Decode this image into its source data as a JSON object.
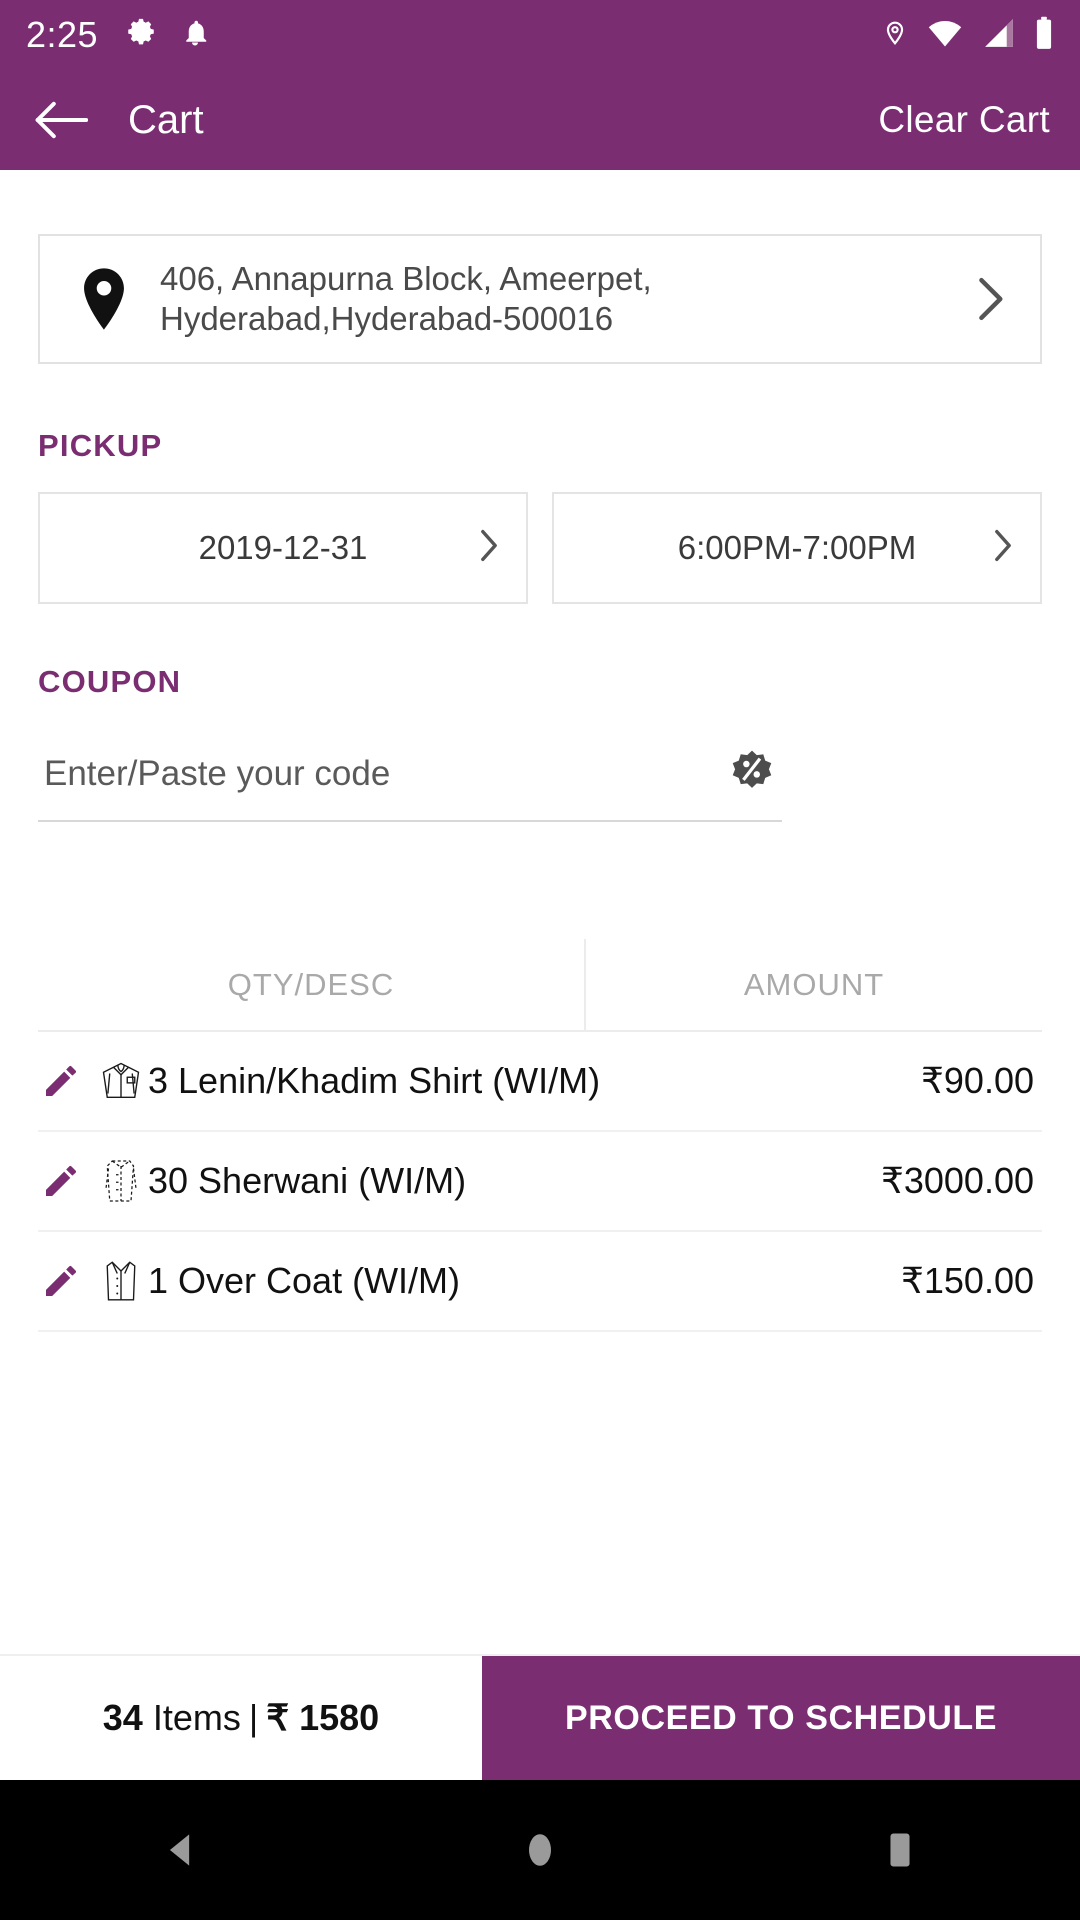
{
  "status_bar": {
    "time": "2:25",
    "left_icons": [
      "gear-icon",
      "bell-icon"
    ],
    "right_icons": [
      "location-pin-icon",
      "wifi-icon",
      "signal-icon",
      "battery-icon"
    ]
  },
  "app_bar": {
    "back_icon": "arrow-left-icon",
    "title": "Cart",
    "action_label": "Clear Cart"
  },
  "address": {
    "icon": "map-pin-icon",
    "line1": "406, Annapurna Block, Ameerpet,",
    "line2": "Hyderabad,Hyderabad-500016",
    "chevron": "chevron-right-icon"
  },
  "pickup": {
    "label": "PICKUP",
    "date": "2019-12-31",
    "time": "6:00PM-7:00PM"
  },
  "coupon": {
    "label": "COUPON",
    "placeholder": "Enter/Paste your code",
    "value": "",
    "icon": "discount-badge-icon"
  },
  "items_table": {
    "columns": [
      "QTY/DESC",
      "AMOUNT"
    ],
    "rows": [
      {
        "edit_icon": "pencil-icon",
        "garment_icon": "shirt-icon",
        "description": "3 Lenin/Khadim Shirt (WI/M)",
        "amount": "₹90.00"
      },
      {
        "edit_icon": "pencil-icon",
        "garment_icon": "sherwani-icon",
        "description": "30 Sherwani (WI/M)",
        "amount": "₹3000.00"
      },
      {
        "edit_icon": "pencil-icon",
        "garment_icon": "overcoat-icon",
        "description": "1 Over Coat (WI/M)",
        "amount": "₹150.00"
      }
    ]
  },
  "bottom_bar": {
    "item_count": "34",
    "items_word": "Items",
    "separator": "|",
    "total": "₹ 1580",
    "cta_label": "PROCEED TO SCHEDULE"
  },
  "nav_bar": {
    "back": "nav-back-icon",
    "home": "nav-home-icon",
    "recents": "nav-recents-icon"
  },
  "colors": {
    "brand_purple": "#7B2D72",
    "accent_pencil": "#7B2D72",
    "text_dark": "#111111",
    "text_muted": "#a9a9a9"
  }
}
